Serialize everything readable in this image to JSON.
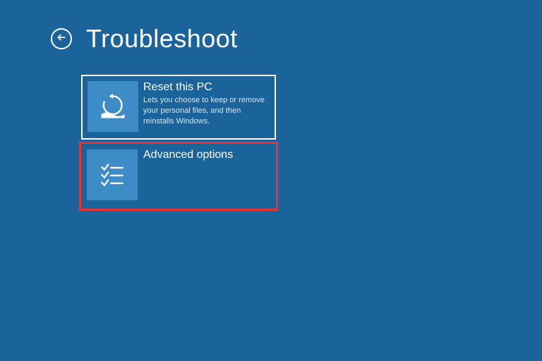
{
  "header": {
    "title": "Troubleshoot"
  },
  "tiles": {
    "reset": {
      "title": "Reset this PC",
      "description": "Lets you choose to keep or remove your personal files, and then reinstalls Windows."
    },
    "advanced": {
      "title": "Advanced options"
    }
  }
}
